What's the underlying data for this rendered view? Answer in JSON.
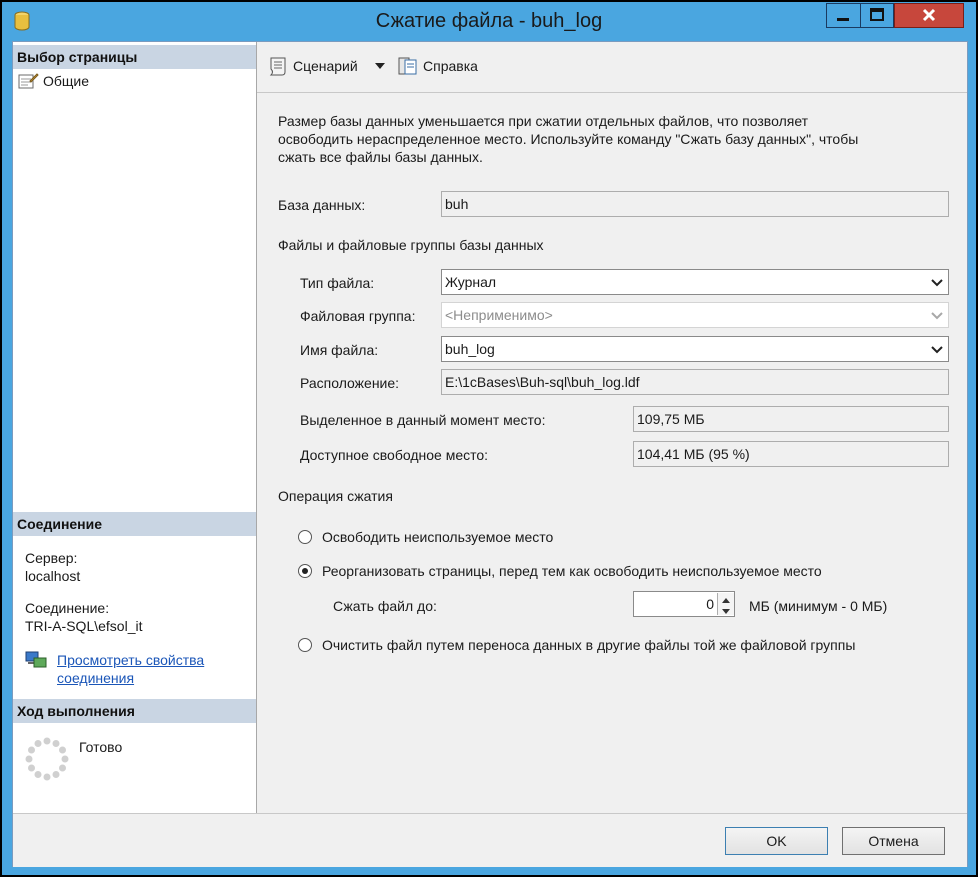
{
  "window": {
    "title": "Сжатие файла - buh_log"
  },
  "left_pane": {
    "select_page_header": "Выбор страницы",
    "pages": [
      {
        "label": "Общие",
        "icon": "properties-page-icon"
      }
    ],
    "connection_header": "Соединение",
    "server_label": "Сервер:",
    "server_value": "localhost",
    "connection_label": "Соединение:",
    "connection_value": "TRI-A-SQL\\efsol_it",
    "view_connection_link_line1": "Просмотреть свойства",
    "view_connection_link_line2": "соединения",
    "progress_header": "Ход выполнения",
    "progress_status": "Готово"
  },
  "toolbar": {
    "script_label": "Сценарий",
    "help_label": "Справка"
  },
  "main": {
    "description_line1": "Размер базы данных уменьшается при сжатии отдельных файлов, что позволяет",
    "description_line2": "освободить нераспределенное место. Используйте команду \"Сжать базу данных\", чтобы",
    "description_line3": "сжать все файлы базы данных.",
    "database_label": "База данных:",
    "database_value": "buh",
    "files_group_label": "Файлы и файловые группы базы данных",
    "file_type_label": "Тип файла:",
    "file_type_value": "Журнал",
    "filegroup_label": "Файловая группа:",
    "filegroup_value": "<Неприменимо>",
    "file_name_label": "Имя файла:",
    "file_name_value": "buh_log",
    "location_label": "Расположение:",
    "location_value": "E:\\1cBases\\Buh-sql\\buh_log.ldf",
    "allocated_label": "Выделенное в данный момент место:",
    "allocated_value": "109,75 МБ",
    "free_label": "Доступное свободное место:",
    "free_value": "104,41 МБ (95 %)",
    "shrink_op_label": "Операция сжатия",
    "option_release_label": "Освободить неиспользуемое место",
    "option_reorganize_label": "Реорганизовать страницы, перед тем как освободить неиспользуемое место",
    "shrink_to_label": "Сжать файл до:",
    "shrink_to_value": "0",
    "shrink_to_unit": "МБ (минимум - 0 МБ)",
    "option_empty_label": "Очистить файл путем переноса данных в другие файлы той же файловой группы",
    "selected_option": "reorganize"
  },
  "footer": {
    "ok_label": "OK",
    "cancel_label": "Отмена"
  }
}
